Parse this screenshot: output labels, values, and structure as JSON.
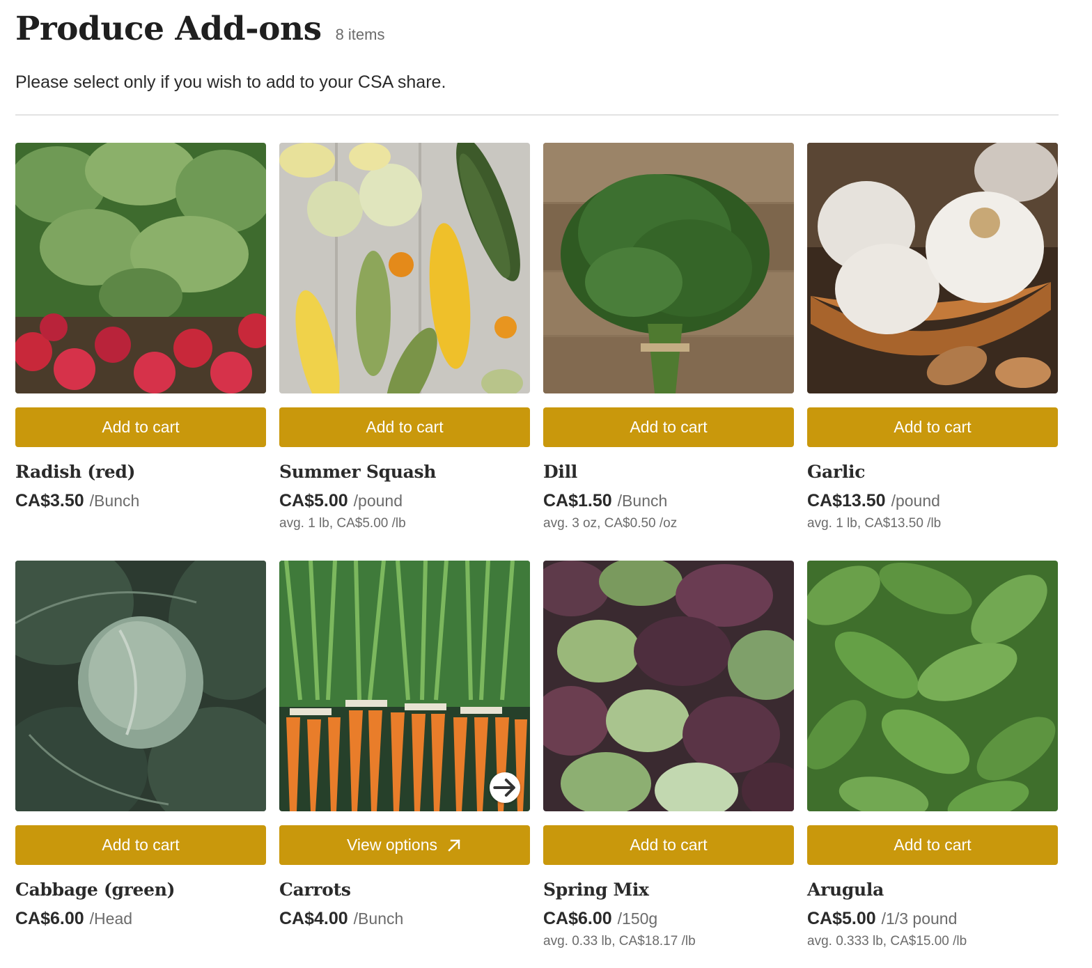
{
  "header": {
    "title": "Produce Add-ons",
    "count": "8 items",
    "subtitle": "Please select only if you wish to add to your CSA share."
  },
  "colors": {
    "button": "#c9980c",
    "divider": "#e2e2e2"
  },
  "products": [
    {
      "name": "Radish (red)",
      "price": "CA$3.50",
      "unit": "/Bunch",
      "avg": "",
      "button": "Add to cart",
      "image": "radish-photo"
    },
    {
      "name": "Summer Squash",
      "price": "CA$5.00",
      "unit": "/pound",
      "avg": "avg. 1 lb, CA$5.00 /lb",
      "button": "Add to cart",
      "image": "squash-photo"
    },
    {
      "name": "Dill",
      "price": "CA$1.50",
      "unit": "/Bunch",
      "avg": "avg. 3 oz, CA$0.50 /oz",
      "button": "Add to cart",
      "image": "dill-photo"
    },
    {
      "name": "Garlic",
      "price": "CA$13.50",
      "unit": "/pound",
      "avg": "avg. 1 lb, CA$13.50 /lb",
      "button": "Add to cart",
      "image": "garlic-photo"
    },
    {
      "name": "Cabbage (green)",
      "price": "CA$6.00",
      "unit": "/Head",
      "avg": "",
      "button": "Add to cart",
      "image": "cabbage-photo"
    },
    {
      "name": "Carrots",
      "price": "CA$4.00",
      "unit": "/Bunch",
      "avg": "",
      "button": "View options",
      "image": "carrots-photo"
    },
    {
      "name": "Spring Mix",
      "price": "CA$6.00",
      "unit": "/150g",
      "avg": "avg. 0.33 lb, CA$18.17 /lb",
      "button": "Add to cart",
      "image": "spring-mix-photo"
    },
    {
      "name": "Arugula",
      "price": "CA$5.00",
      "unit": "/1/3 pound",
      "avg": "avg. 0.333 lb, CA$15.00 /lb",
      "button": "Add to cart",
      "image": "arugula-photo"
    }
  ]
}
